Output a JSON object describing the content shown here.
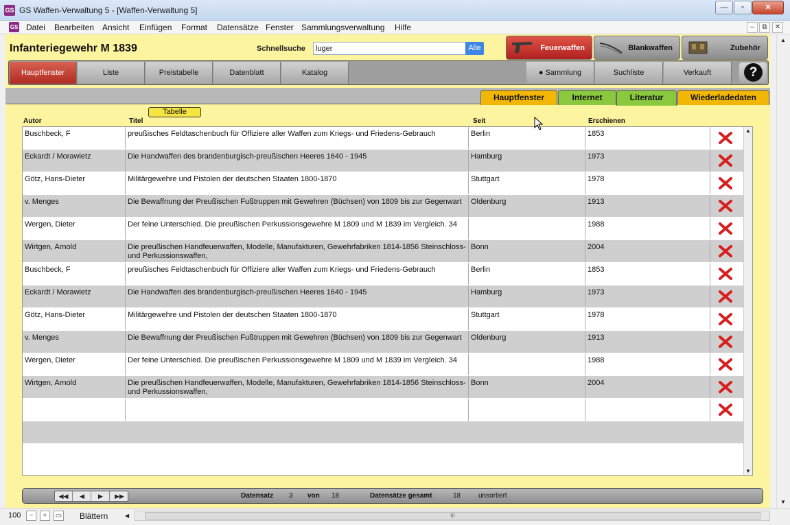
{
  "window": {
    "title": "GS Waffen-Verwaltung 5 - [Waffen-Verwaltung 5]",
    "app_icon": "gs-app-icon",
    "minimize": "—",
    "maximize": "▫",
    "close": "✕"
  },
  "menu": {
    "items": [
      "Datei",
      "Bearbeiten",
      "Ansicht",
      "Einfügen",
      "Format",
      "Datensätze",
      "Fenster",
      "Sammlungsverwaltung",
      "Hilfe"
    ],
    "mdi_minimize": "–",
    "mdi_restore": "⧉",
    "mdi_close": "✕"
  },
  "header": {
    "record_title": "Infanteriegewehr M 1839",
    "quicksearch_label": "Schnellsuche",
    "quicksearch_value": "luger",
    "quicksearch_all": "Alle"
  },
  "categories": [
    {
      "label": "Feuerwaffen",
      "icon": "pistol-icon",
      "active": true
    },
    {
      "label": "Blankwaffen",
      "icon": "sword-icon",
      "active": false
    },
    {
      "label": "Zubehör",
      "icon": "pouch-icon",
      "active": false
    }
  ],
  "nav": {
    "left": [
      "Hauptfenster",
      "Liste",
      "Preistabelle",
      "Datenblatt",
      "Katalog"
    ],
    "right": [
      "Sammlung",
      "Suchliste",
      "Verkauft"
    ],
    "help": "?",
    "sammlung_bullet": "●"
  },
  "tabs": [
    {
      "label": "Hauptfenster",
      "color": "#f2b705"
    },
    {
      "label": "Internet",
      "color": "#8ac93e"
    },
    {
      "label": "Literatur",
      "color": "#8ac93e"
    },
    {
      "label": "Wiederladedaten",
      "color": "#f2b705"
    }
  ],
  "table": {
    "tabelle_button": "Tabelle",
    "columns": [
      "Autor",
      "Titel",
      "Seit",
      "Erschienen"
    ],
    "rows": [
      {
        "autor": "Buschbeck, F",
        "titel": "preußisches Feldtaschenbuch für Offiziere aller Waffen zum Kriegs- und Friedens-Gebrauch",
        "seit": "Berlin",
        "erschienen": "1853"
      },
      {
        "autor": "Eckardt / Morawietz",
        "titel": "Die Handwaffen des brandenburgisch-preußischen Heeres 1640 - 1945",
        "seit": "Hamburg",
        "erschienen": "1973"
      },
      {
        "autor": "Götz, Hans-Dieter",
        "titel": "Militärgewehre und Pistolen der deutschen Staaten 1800-1870",
        "seit": "Stuttgart",
        "erschienen": "1978"
      },
      {
        "autor": "v. Menges",
        "titel": "Die Bewaffnung der Preußischen Fußtruppen mit Gewehren (Büchsen) von 1809 bis zur Gegenwart",
        "seit": "Oldenburg",
        "erschienen": "1913"
      },
      {
        "autor": "Wergen, Dieter",
        "titel": "Der feine Unterschied. Die preußischen Perkussionsgewehre M 1809 und M 1839 im Vergleich. 34",
        "seit": "",
        "erschienen": "1988"
      },
      {
        "autor": "Wirtgen, Arnold",
        "titel": "Die preußischen Handfeuerwaffen, Modelle, Manufakturen, Gewehrfabriken 1814-1856 Steinschloss- und Perkussionswaffen,",
        "seit": "Bonn",
        "erschienen": "2004"
      },
      {
        "autor": "Buschbeck, F",
        "titel": "preußisches Feldtaschenbuch für Offiziere aller Waffen zum Kriegs- und Friedens-Gebrauch",
        "seit": "Berlin",
        "erschienen": "1853"
      },
      {
        "autor": "Eckardt / Morawietz",
        "titel": "Die Handwaffen des brandenburgisch-preußischen Heeres 1640 - 1945",
        "seit": "Hamburg",
        "erschienen": "1973"
      },
      {
        "autor": "Götz, Hans-Dieter",
        "titel": "Militärgewehre und Pistolen der deutschen Staaten 1800-1870",
        "seit": "Stuttgart",
        "erschienen": "1978"
      },
      {
        "autor": "v. Menges",
        "titel": "Die Bewaffnung der Preußischen Fußtruppen mit Gewehren (Büchsen) von 1809 bis zur Gegenwart",
        "seit": "Oldenburg",
        "erschienen": "1913"
      },
      {
        "autor": "Wergen, Dieter",
        "titel": "Der feine Unterschied. Die preußischen Perkussionsgewehre M 1809 und M 1839 im Vergleich. 34",
        "seit": "",
        "erschienen": "1988"
      },
      {
        "autor": "Wirtgen, Arnold",
        "titel": "Die preußischen Handfeuerwaffen, Modelle, Manufakturen, Gewehrfabriken 1814-1856 Steinschloss- und Perkussionswaffen,",
        "seit": "Bonn",
        "erschienen": "2004"
      },
      {
        "autor": "",
        "titel": "",
        "seit": "",
        "erschienen": ""
      }
    ],
    "delete_icon": "delete-x-icon",
    "delete_color": "#d81e1e"
  },
  "status": {
    "nav_buttons": [
      "◀◀",
      "◀",
      "▶",
      "▶▶"
    ],
    "datensatz_label": "Datensatz",
    "datensatz_value": "3",
    "von_label": "von",
    "von_value": "18",
    "gesamt_label": "Datensätze gesamt",
    "gesamt_value": "18",
    "sort_state": "unsortiert"
  },
  "bottom": {
    "zoom": "100",
    "zoom_out": "−",
    "zoom_in": "+",
    "layout": "▭",
    "mode": "Blättern",
    "mode_arrow": "◀",
    "thumb_grip": "III"
  }
}
